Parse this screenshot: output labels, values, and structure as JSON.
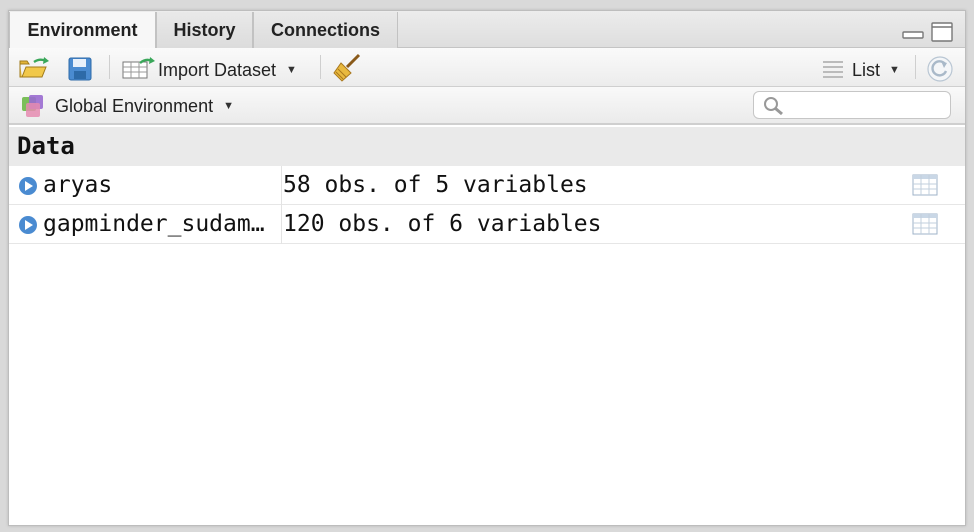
{
  "tabs": [
    {
      "label": "Environment",
      "active": true
    },
    {
      "label": "History",
      "active": false
    },
    {
      "label": "Connections",
      "active": false
    }
  ],
  "toolbar": {
    "import_label": "Import Dataset",
    "view_label": "List"
  },
  "env": {
    "selector_label": "Global Environment",
    "search_placeholder": ""
  },
  "section": {
    "title": "Data"
  },
  "rows": [
    {
      "name": "aryas",
      "value": "58 obs. of 5 variables"
    },
    {
      "name": "gapminder_sudam…",
      "value": "120 obs. of 6 variables"
    }
  ],
  "colors": {
    "accent_blue": "#4a8bd1",
    "arrow_green": "#3aa75a"
  },
  "icons": [
    "open-folder-icon",
    "save-icon",
    "import-table-icon",
    "broom-icon",
    "list-icon",
    "refresh-icon",
    "global-env-icon",
    "search-icon",
    "expand-arrow-icon",
    "table-grid-icon",
    "minimize-icon",
    "maximize-icon"
  ]
}
